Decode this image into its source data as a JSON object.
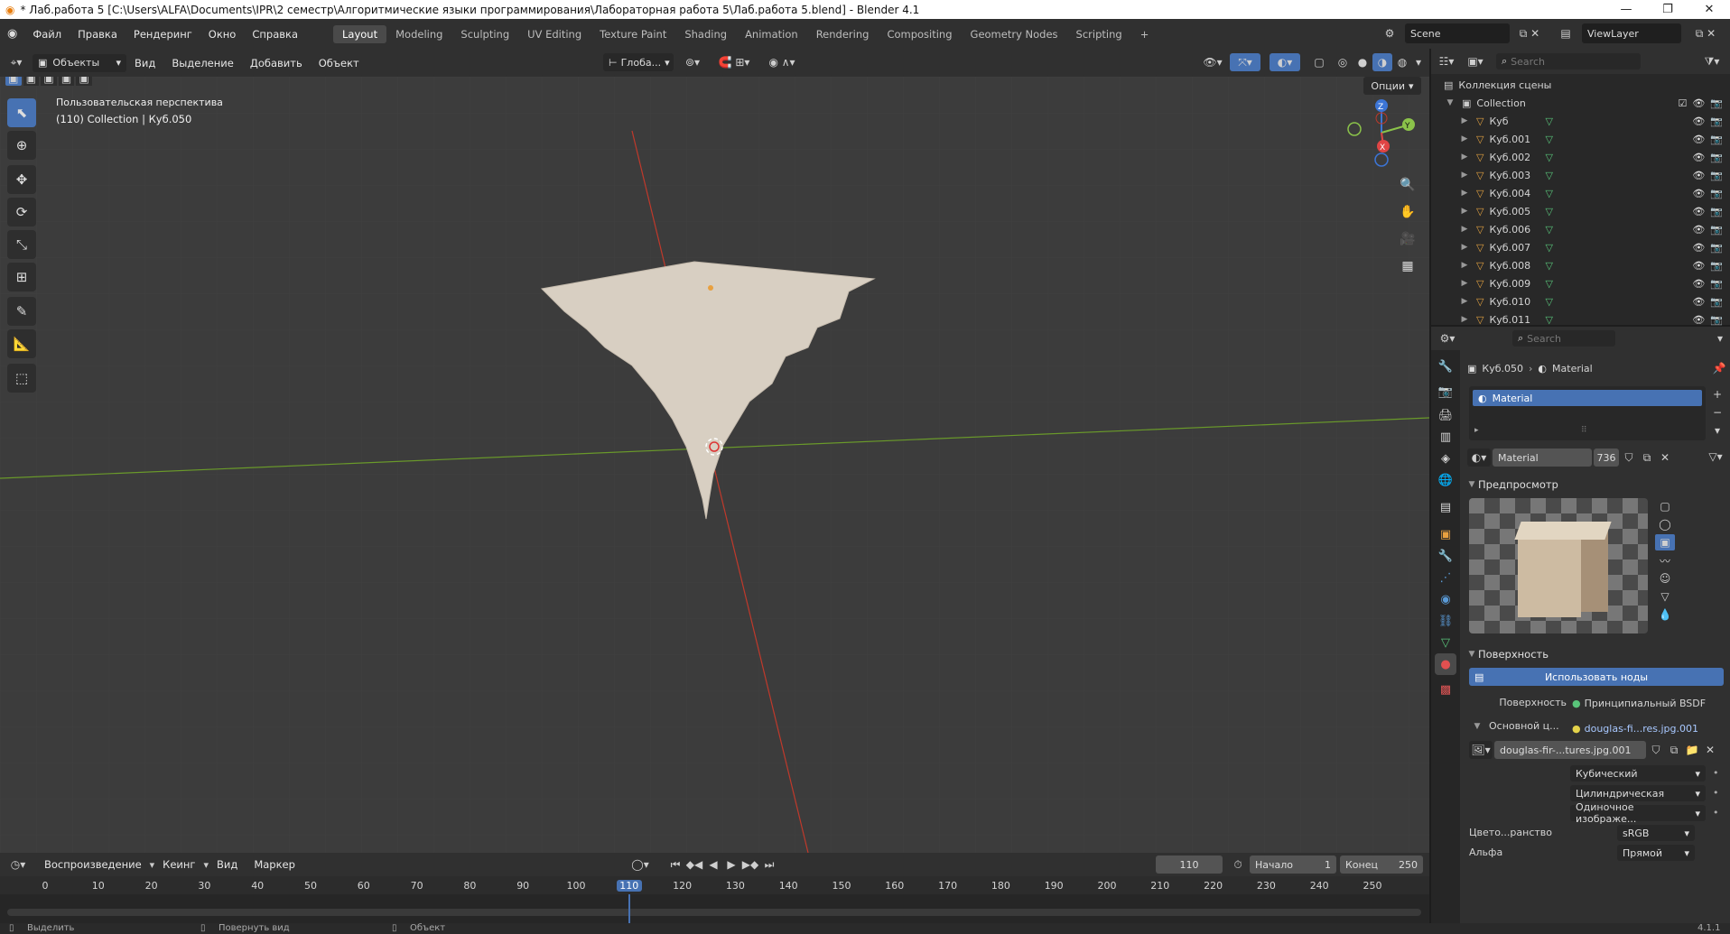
{
  "window": {
    "title": "* Лаб.работа 5 [C:\\Users\\ALFA\\Documents\\IPR\\2 семестр\\Алгоритмические языки программирования\\Лабораторная работа 5\\Лаб.работа 5.blend] - Blender 4.1",
    "minimize": "—",
    "maximize": "❐",
    "close": "✕"
  },
  "menu": {
    "file": "Файл",
    "edit": "Правка",
    "render": "Рендеринг",
    "window": "Окно",
    "help": "Справка"
  },
  "workspaces": [
    "Layout",
    "Modeling",
    "Sculpting",
    "UV Editing",
    "Texture Paint",
    "Shading",
    "Animation",
    "Rendering",
    "Compositing",
    "Geometry Nodes",
    "Scripting"
  ],
  "add_workspace": "+",
  "scene": {
    "name": "Scene",
    "viewlayer": "ViewLayer"
  },
  "viewport_header": {
    "mode": "Объекты",
    "view": "Вид",
    "select": "Выделение",
    "add": "Добавить",
    "object": "Объект",
    "transform_orientation": "Глоба...",
    "options": "Опции"
  },
  "viewport": {
    "perspective": "Пользовательская перспектива",
    "info": "(110) Collection | Куб.050"
  },
  "gizmo": {
    "x": "X",
    "y": "Y",
    "z": "Z"
  },
  "outliner": {
    "search_placeholder": "Search",
    "scene_collection": "Коллекция сцены",
    "collection": "Collection",
    "items": [
      "Куб",
      "Куб.001",
      "Куб.002",
      "Куб.003",
      "Куб.004",
      "Куб.005",
      "Куб.006",
      "Куб.007",
      "Куб.008",
      "Куб.009",
      "Куб.010",
      "Куб.011"
    ]
  },
  "properties": {
    "search_placeholder": "Search",
    "breadcrumb_object": "Куб.050",
    "breadcrumb_material": "Material",
    "slot_name": "Material",
    "material_name": "Material",
    "user_count": "736",
    "preview_panel": "Предпросмотр",
    "surface_panel": "Поверхность",
    "use_nodes": "Использовать ноды",
    "surface_label": "Поверхность",
    "surface_value": "Принципиальный BSDF",
    "base_color_label": "Основной ц...",
    "base_color_value": "douglas-fi...res.jpg.001",
    "image_name": "douglas-fir-...tures.jpg.001",
    "interpolation": "Кубический",
    "projection": "Цилиндрическая",
    "extension": "Одиночное изображе...",
    "colorspace_label": "Цвето...ранство",
    "colorspace_value": "sRGB",
    "alpha_label": "Альфа",
    "alpha_value": "Прямой"
  },
  "timeline": {
    "playback": "Воспроизведение",
    "keying": "Кеинг",
    "view": "Вид",
    "marker": "Маркер",
    "current_frame": "110",
    "start_label": "Начало",
    "start": "1",
    "end_label": "Конец",
    "end": "250",
    "ticks": [
      "0",
      "10",
      "20",
      "30",
      "40",
      "50",
      "60",
      "70",
      "80",
      "90",
      "100",
      "110",
      "120",
      "130",
      "140",
      "150",
      "160",
      "170",
      "180",
      "190",
      "200",
      "210",
      "220",
      "230",
      "240",
      "250"
    ]
  },
  "statusbar": {
    "select": "Выделить",
    "rotate": "Повернуть вид",
    "object": "Объект",
    "version": "4.1.1"
  },
  "colors": {
    "accent": "#4772b3",
    "bg": "#303030",
    "viewport": "#3c3c3c",
    "x_axis": "#c0392b",
    "y_axis": "#6a9a2a",
    "mesh_icon": "#e0a040",
    "data_icon": "#59c47a"
  }
}
